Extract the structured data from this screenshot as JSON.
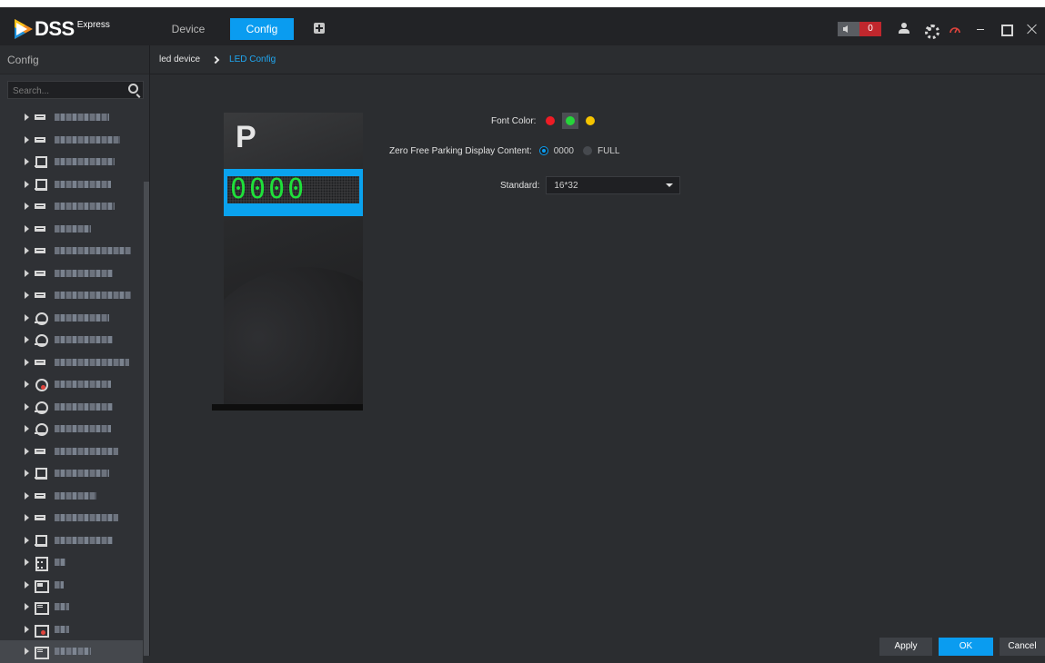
{
  "app": {
    "logo_text": "DSS",
    "logo_sub": "Express",
    "accent": "#0a9cf0"
  },
  "top_tabs": [
    {
      "label": "Device",
      "active": false
    },
    {
      "label": "Config",
      "active": true
    }
  ],
  "toolbar": {
    "alarm_count": "0",
    "icons": [
      "sound-icon",
      "user-icon",
      "gear-icon",
      "performance-icon",
      "minimize-icon",
      "maximize-icon",
      "close-icon"
    ]
  },
  "sidebar": {
    "title": "Config",
    "search_placeholder": "Search...",
    "items": [
      {
        "icon": "led-device-icon",
        "selected": false
      },
      {
        "icon": "led-device-icon",
        "selected": false
      },
      {
        "icon": "parking-pole-icon",
        "selected": false
      },
      {
        "icon": "parking-pole-icon",
        "selected": false
      },
      {
        "icon": "led-device-icon",
        "selected": false
      },
      {
        "icon": "led-device-icon",
        "selected": false
      },
      {
        "icon": "led-device-icon",
        "selected": false
      },
      {
        "icon": "led-device-icon",
        "selected": false
      },
      {
        "icon": "led-device-icon",
        "selected": false
      },
      {
        "icon": "camera-icon",
        "selected": false
      },
      {
        "icon": "camera-icon",
        "selected": false
      },
      {
        "icon": "led-device-icon",
        "selected": false
      },
      {
        "icon": "camera-offline-icon",
        "selected": false
      },
      {
        "icon": "camera-icon",
        "selected": false
      },
      {
        "icon": "camera-icon",
        "selected": false
      },
      {
        "icon": "led-device-icon",
        "selected": false
      },
      {
        "icon": "parking-pole-icon",
        "selected": false
      },
      {
        "icon": "led-device-icon",
        "selected": false
      },
      {
        "icon": "led-device-icon",
        "selected": false
      },
      {
        "icon": "parking-pole-icon",
        "selected": false
      },
      {
        "icon": "calculator-icon",
        "selected": false
      },
      {
        "icon": "screen-icon",
        "selected": false
      },
      {
        "icon": "led-box-icon",
        "selected": false
      },
      {
        "icon": "led-box-offline-icon",
        "selected": false
      },
      {
        "icon": "led-box-icon",
        "selected": true
      }
    ]
  },
  "breadcrumb": {
    "root": "led device",
    "current": "LED Config"
  },
  "preview": {
    "letter": "P",
    "display_text": "0000",
    "display_color": "#1fe03a"
  },
  "form": {
    "font_color_label": "Font Color:",
    "font_colors": [
      {
        "name": "red",
        "hex": "#ee1c25",
        "selected": false
      },
      {
        "name": "green",
        "hex": "#26d43a",
        "selected": true
      },
      {
        "name": "yellow",
        "hex": "#f5c400",
        "selected": false
      }
    ],
    "zero_free_label": "Zero Free Parking Display Content:",
    "zero_free_options": [
      {
        "label": "0000",
        "checked": true
      },
      {
        "label": "FULL",
        "checked": false
      }
    ],
    "standard_label": "Standard:",
    "standard_value": "16*32"
  },
  "buttons": {
    "apply": "Apply",
    "ok": "OK",
    "cancel": "Cancel"
  }
}
